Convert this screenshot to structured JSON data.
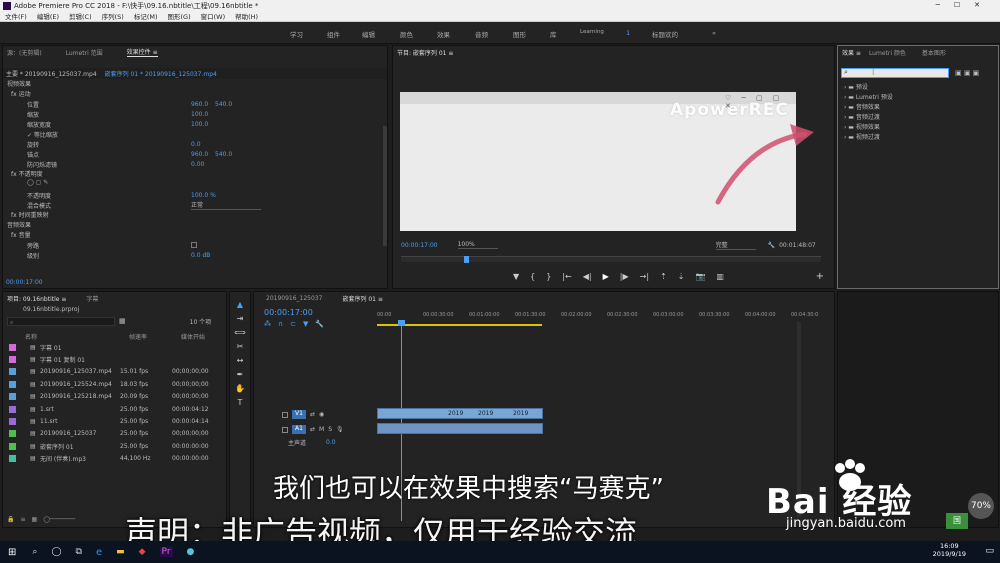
{
  "window": {
    "title": "Adobe Premiere Pro CC 2018 - F:\\快手\\09.16.nbtitle\\工程\\09.16nbtitle *",
    "controls": [
      "─",
      "☐",
      "✕"
    ]
  },
  "menu": [
    "文件(F)",
    "编辑(E)",
    "剪辑(C)",
    "序列(S)",
    "标记(M)",
    "图形(G)",
    "窗口(W)",
    "帮助(H)"
  ],
  "workspaces": [
    "学习",
    "组件",
    "编辑",
    "颜色",
    "效果",
    "音频",
    "图形",
    "库",
    "Learning",
    "1",
    "标题欢的",
    "»"
  ],
  "effect_controls": {
    "tabs": [
      "源：(无剪辑)",
      "Lumetri 范围",
      "效果控件 ≡"
    ],
    "header": {
      "master": "主要 * 20190916_125037.mp4",
      "seq": "嵌套序列 01 * 20190916_125037.mp4"
    },
    "section_video": "视频效果",
    "motion": "fx 运动",
    "props": [
      {
        "name": "位置",
        "v1": "960.0",
        "v2": "540.0"
      },
      {
        "name": "缩放",
        "v1": "100.0",
        "v2": ""
      },
      {
        "name": "缩放宽度",
        "v1": "100.0",
        "v2": ""
      },
      {
        "name": "✓ 等比缩放",
        "v1": "",
        "v2": ""
      },
      {
        "name": "旋转",
        "v1": "0.0",
        "v2": ""
      },
      {
        "name": "锚点",
        "v1": "960.0",
        "v2": "540.0"
      },
      {
        "name": "防闪烁滤镜",
        "v1": "0.00",
        "v2": ""
      }
    ],
    "opacity": "fx 不透明度",
    "opacity_props": [
      {
        "name": "不透明度",
        "v1": "100.0 %"
      },
      {
        "name": "混合模式",
        "v1": "正常"
      }
    ],
    "time_remap": "fx 时间重映射",
    "section_audio": "音频效果",
    "volume": "fx 音量",
    "audio_props": [
      {
        "name": "旁路",
        "v1": ""
      },
      {
        "name": "级别",
        "v1": "0.0 dB"
      }
    ],
    "timecode": "00:00:17:00"
  },
  "program": {
    "title": "节目: 嵌套序列 01 ≡",
    "watermark": "ApowerREC",
    "timecode_left": "00:00:17:00",
    "zoom": "100%",
    "quality": "完整",
    "timecode_right": "00:01:48:07"
  },
  "effects": {
    "tabs": [
      "效果 ≡",
      "Lumetri 颜色",
      "基本图形"
    ],
    "search_placeholder": "",
    "tree": [
      "预设",
      "Lumetri 预设",
      "音频效果",
      "音频过渡",
      "视频效果",
      "视频过渡"
    ]
  },
  "project": {
    "tabs": [
      "项目: 09.16nbtitle ≡",
      "字幕"
    ],
    "file": "09.16nbtitle.prproj",
    "count": "10 个项",
    "cols": [
      "名称",
      "帧速率",
      "媒体开始"
    ],
    "items": [
      {
        "name": "字幕 01",
        "fps": "",
        "start": "",
        "color": "#d36ad6"
      },
      {
        "name": "字幕 01 复制 01",
        "fps": "",
        "start": "",
        "color": "#d36ad6"
      },
      {
        "name": "20190916_125037.mp4",
        "fps": "15.01 fps",
        "start": "00;00;00;00",
        "color": "#5aa0d8"
      },
      {
        "name": "20190916_125524.mp4",
        "fps": "18.03 fps",
        "start": "00;00;00;00",
        "color": "#5aa0d8"
      },
      {
        "name": "20190916_125218.mp4",
        "fps": "20.09 fps",
        "start": "00;00;00;00",
        "color": "#5aa0d8"
      },
      {
        "name": "1.srt",
        "fps": "25.00 fps",
        "start": "00:00:04:12",
        "color": "#9b6ad6"
      },
      {
        "name": "11.srt",
        "fps": "25.00 fps",
        "start": "00:00:04:14",
        "color": "#9b6ad6"
      },
      {
        "name": "20190916_125037",
        "fps": "25.00 fps",
        "start": "00;00;00;00",
        "color": "#4fbf4f"
      },
      {
        "name": "嵌套序列 01",
        "fps": "25.00 fps",
        "start": "00:00:00:00",
        "color": "#4fbf4f"
      },
      {
        "name": "无间 (伴奏).mp3",
        "fps": "44,100 Hz",
        "start": "00:00:00:00",
        "color": "#3fc0a0"
      }
    ]
  },
  "timeline": {
    "tabs": [
      "20190916_125037",
      "嵌套序列 01 ≡"
    ],
    "timecode": "00:00:17:00",
    "ruler": [
      "00:00",
      "00:00:30:00",
      "00:01:00:00",
      "00:01:30:00",
      "00:02:00:00",
      "00:02:30:00",
      "00:03:00:00",
      "00:03:30:00",
      "00:04:00:00",
      "00:04:30:0"
    ],
    "tracks": [
      "V1",
      "A1",
      "主声道"
    ],
    "master_val": "0.0",
    "clip_labels": [
      "2019",
      "2019",
      "2019"
    ]
  },
  "subtitle": "我们也可以在效果中搜索“马赛克”",
  "disclaimer": "声明：非广告视频，仅用于经验交流",
  "brand": {
    "logo": "Bai  经验",
    "url": "jingyan.baidu.com"
  },
  "taskbar": {
    "time": "16:09",
    "date": "2019/9/19",
    "lang": "中",
    "pct": "70%",
    "badge": "国"
  }
}
